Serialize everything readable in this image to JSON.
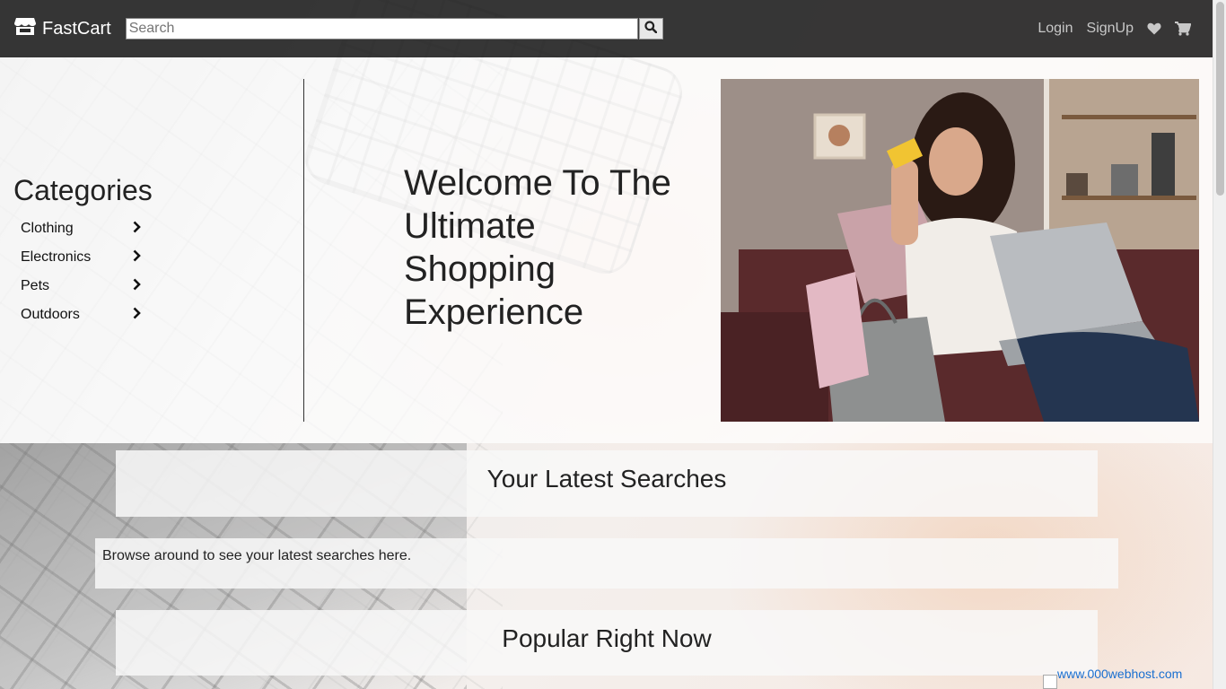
{
  "navbar": {
    "brand": "FastCart",
    "search_placeholder": "Search",
    "login": "Login",
    "signup": "SignUp"
  },
  "hero": {
    "categories_title": "Categories",
    "categories": [
      "Clothing",
      "Electronics",
      "Pets",
      "Outdoors"
    ],
    "welcome": "Welcome To The Ultimate Shopping Experience"
  },
  "sections": {
    "latest_title": "Your Latest Searches",
    "latest_body": "Browse around to see your latest searches here.",
    "popular_title": "Popular Right Now"
  },
  "host_badge": "www.000webhost.com",
  "icons": {
    "brand": "store-icon",
    "search": "search-icon",
    "wishlist": "heart-icon",
    "cart": "cart-icon",
    "category_arrow": "chevron-right-icon"
  }
}
